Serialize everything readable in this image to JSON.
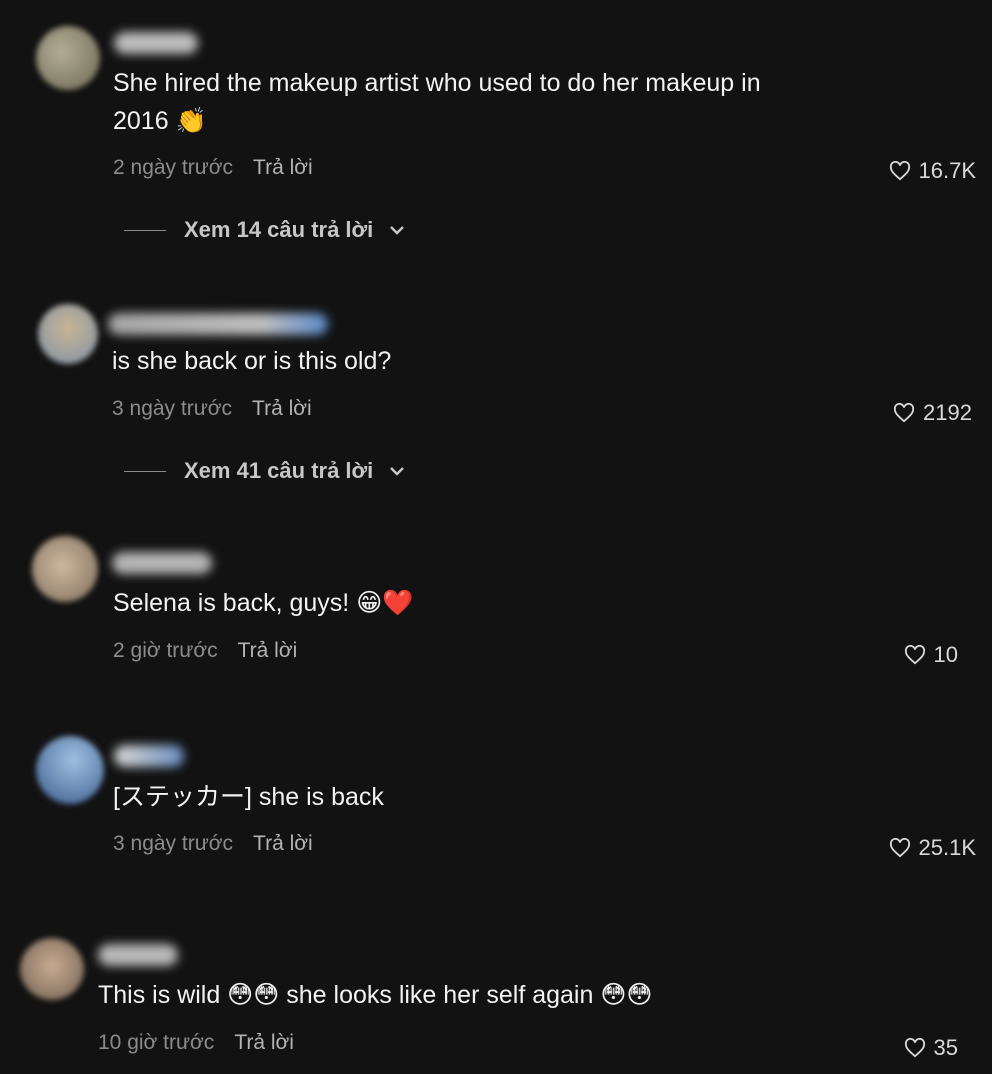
{
  "comments": [
    {
      "text_line1": "She hired the makeup artist who used to do her makeup in",
      "text_line2": "2016 👏",
      "time": "2 ngày trước",
      "reply": "Trả lời",
      "likes": "16.7K",
      "view_replies": "Xem 14 câu trả lời",
      "avatar_colors": [
        "#6f6b58",
        "#a9a38b"
      ]
    },
    {
      "text": "is she back or is this old?",
      "time": "3 ngày trước",
      "reply": "Trả lời",
      "likes": "2192",
      "view_replies": "Xem 41 câu trả lời",
      "avatar_colors": [
        "#8da0b8",
        "#c9b59a"
      ]
    },
    {
      "text": "Selena is back, guys! 😁❤️",
      "time": "2 giờ trước",
      "reply": "Trả lời",
      "likes": "10",
      "avatar_colors": [
        "#8a7a66",
        "#c8b59c"
      ]
    },
    {
      "text": "[ステッカー] she is back",
      "time": "3 ngày trước",
      "reply": "Trả lời",
      "likes": "25.1K",
      "avatar_colors": [
        "#3f5f90",
        "#8ab0d6"
      ]
    },
    {
      "text": "This is wild 😳😳 she looks like her self again 😳😳",
      "time": "10 giờ trước",
      "reply": "Trả lời",
      "likes": "35",
      "avatar_colors": [
        "#7a6a5a",
        "#c6aa90"
      ]
    }
  ]
}
